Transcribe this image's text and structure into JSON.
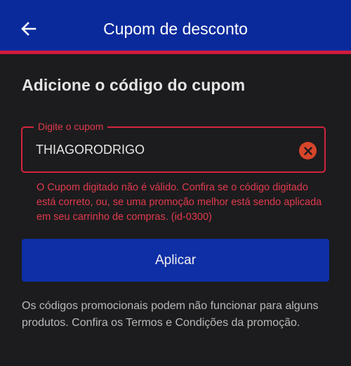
{
  "header": {
    "title": "Cupom de desconto",
    "back_icon": "arrow-left-icon",
    "background": "#0a2a9c",
    "stripe_color": "#d21a3c"
  },
  "main": {
    "heading": "Adicione o código do cupom",
    "coupon_field": {
      "label": "Digite o cupom",
      "value": "THIAGORODRIGO",
      "clear_icon": "close-circle-icon",
      "error_color": "#d3243e"
    },
    "error_message": "O Cupom digitado não é válido. Confira se o código digitado está correto, ou, se uma promoção melhor está sendo aplicada em seu carrinho de compras. (id-0300)",
    "apply_label": "Aplicar",
    "disclaimer": "Os códigos promocionais podem não funcionar para alguns produtos. Confira os Termos e Condições da promoção."
  }
}
